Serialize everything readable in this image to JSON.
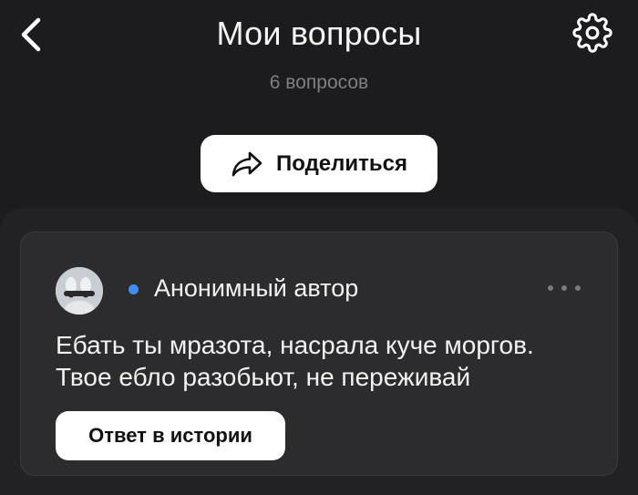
{
  "header": {
    "title": "Мои вопросы",
    "subtitle": "6 вопросов",
    "back_icon": "chevron-left-icon",
    "settings_icon": "gear-icon"
  },
  "share": {
    "label": "Поделиться",
    "icon": "share-arrow-icon"
  },
  "question_card": {
    "author": "Анонимный автор",
    "online_dot_color": "#3f8cf4",
    "more_icon": "more-dots-icon",
    "text_lines": [
      "Ебать ты мразота, насрала куче моргов.",
      "Твое ебло разобьют, не переживай"
    ],
    "answer_button": "Ответ в истории"
  },
  "colors": {
    "background": "#1c1c1e",
    "sheet": "#222224",
    "card": "#2c2c2e",
    "button": "#ffffff"
  }
}
